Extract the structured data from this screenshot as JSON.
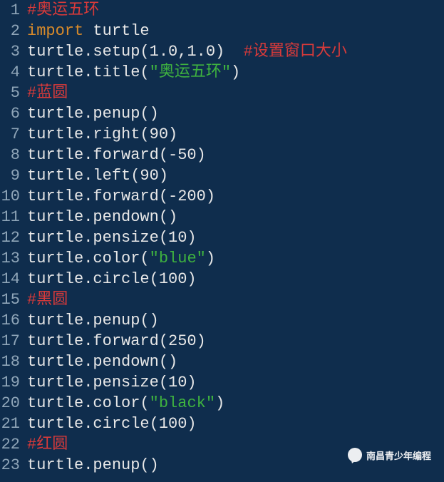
{
  "watermark": "南昌青少年编程",
  "lines": [
    {
      "n": 1,
      "tokens": [
        {
          "cls": "comment",
          "text": "#奥运五环"
        }
      ]
    },
    {
      "n": 2,
      "tokens": [
        {
          "cls": "keyword",
          "text": "import"
        },
        {
          "cls": "default",
          "text": " turtle"
        }
      ]
    },
    {
      "n": 3,
      "tokens": [
        {
          "cls": "default",
          "text": "turtle.setup(1.0,1.0)  "
        },
        {
          "cls": "comment",
          "text": "#设置窗口大小"
        }
      ]
    },
    {
      "n": 4,
      "tokens": [
        {
          "cls": "default",
          "text": "turtle.title("
        },
        {
          "cls": "string",
          "text": "\"奥运五环\""
        },
        {
          "cls": "default",
          "text": ")"
        }
      ]
    },
    {
      "n": 5,
      "tokens": [
        {
          "cls": "comment",
          "text": "#蓝圆"
        }
      ]
    },
    {
      "n": 6,
      "tokens": [
        {
          "cls": "default",
          "text": "turtle.penup()"
        }
      ]
    },
    {
      "n": 7,
      "tokens": [
        {
          "cls": "default",
          "text": "turtle.right(90)"
        }
      ]
    },
    {
      "n": 8,
      "tokens": [
        {
          "cls": "default",
          "text": "turtle.forward(-50)"
        }
      ]
    },
    {
      "n": 9,
      "tokens": [
        {
          "cls": "default",
          "text": "turtle.left(90)"
        }
      ]
    },
    {
      "n": 10,
      "tokens": [
        {
          "cls": "default",
          "text": "turtle.forward(-200)"
        }
      ]
    },
    {
      "n": 11,
      "tokens": [
        {
          "cls": "default",
          "text": "turtle.pendown()"
        }
      ]
    },
    {
      "n": 12,
      "tokens": [
        {
          "cls": "default",
          "text": "turtle.pensize(10)"
        }
      ]
    },
    {
      "n": 13,
      "tokens": [
        {
          "cls": "default",
          "text": "turtle.color("
        },
        {
          "cls": "string",
          "text": "\"blue\""
        },
        {
          "cls": "default",
          "text": ")"
        }
      ]
    },
    {
      "n": 14,
      "tokens": [
        {
          "cls": "default",
          "text": "turtle.circle(100)"
        }
      ]
    },
    {
      "n": 15,
      "tokens": [
        {
          "cls": "comment",
          "text": "#黑圆"
        }
      ]
    },
    {
      "n": 16,
      "tokens": [
        {
          "cls": "default",
          "text": "turtle.penup()"
        }
      ]
    },
    {
      "n": 17,
      "tokens": [
        {
          "cls": "default",
          "text": "turtle.forward(250)"
        }
      ]
    },
    {
      "n": 18,
      "tokens": [
        {
          "cls": "default",
          "text": "turtle.pendown()"
        }
      ]
    },
    {
      "n": 19,
      "tokens": [
        {
          "cls": "default",
          "text": "turtle.pensize(10)"
        }
      ]
    },
    {
      "n": 20,
      "tokens": [
        {
          "cls": "default",
          "text": "turtle.color("
        },
        {
          "cls": "string",
          "text": "\"black\""
        },
        {
          "cls": "default",
          "text": ")"
        }
      ]
    },
    {
      "n": 21,
      "tokens": [
        {
          "cls": "default",
          "text": "turtle.circle(100)"
        }
      ]
    },
    {
      "n": 22,
      "tokens": [
        {
          "cls": "comment",
          "text": "#红圆"
        }
      ]
    },
    {
      "n": 23,
      "tokens": [
        {
          "cls": "default",
          "text": "turtle.penup()"
        }
      ]
    }
  ]
}
